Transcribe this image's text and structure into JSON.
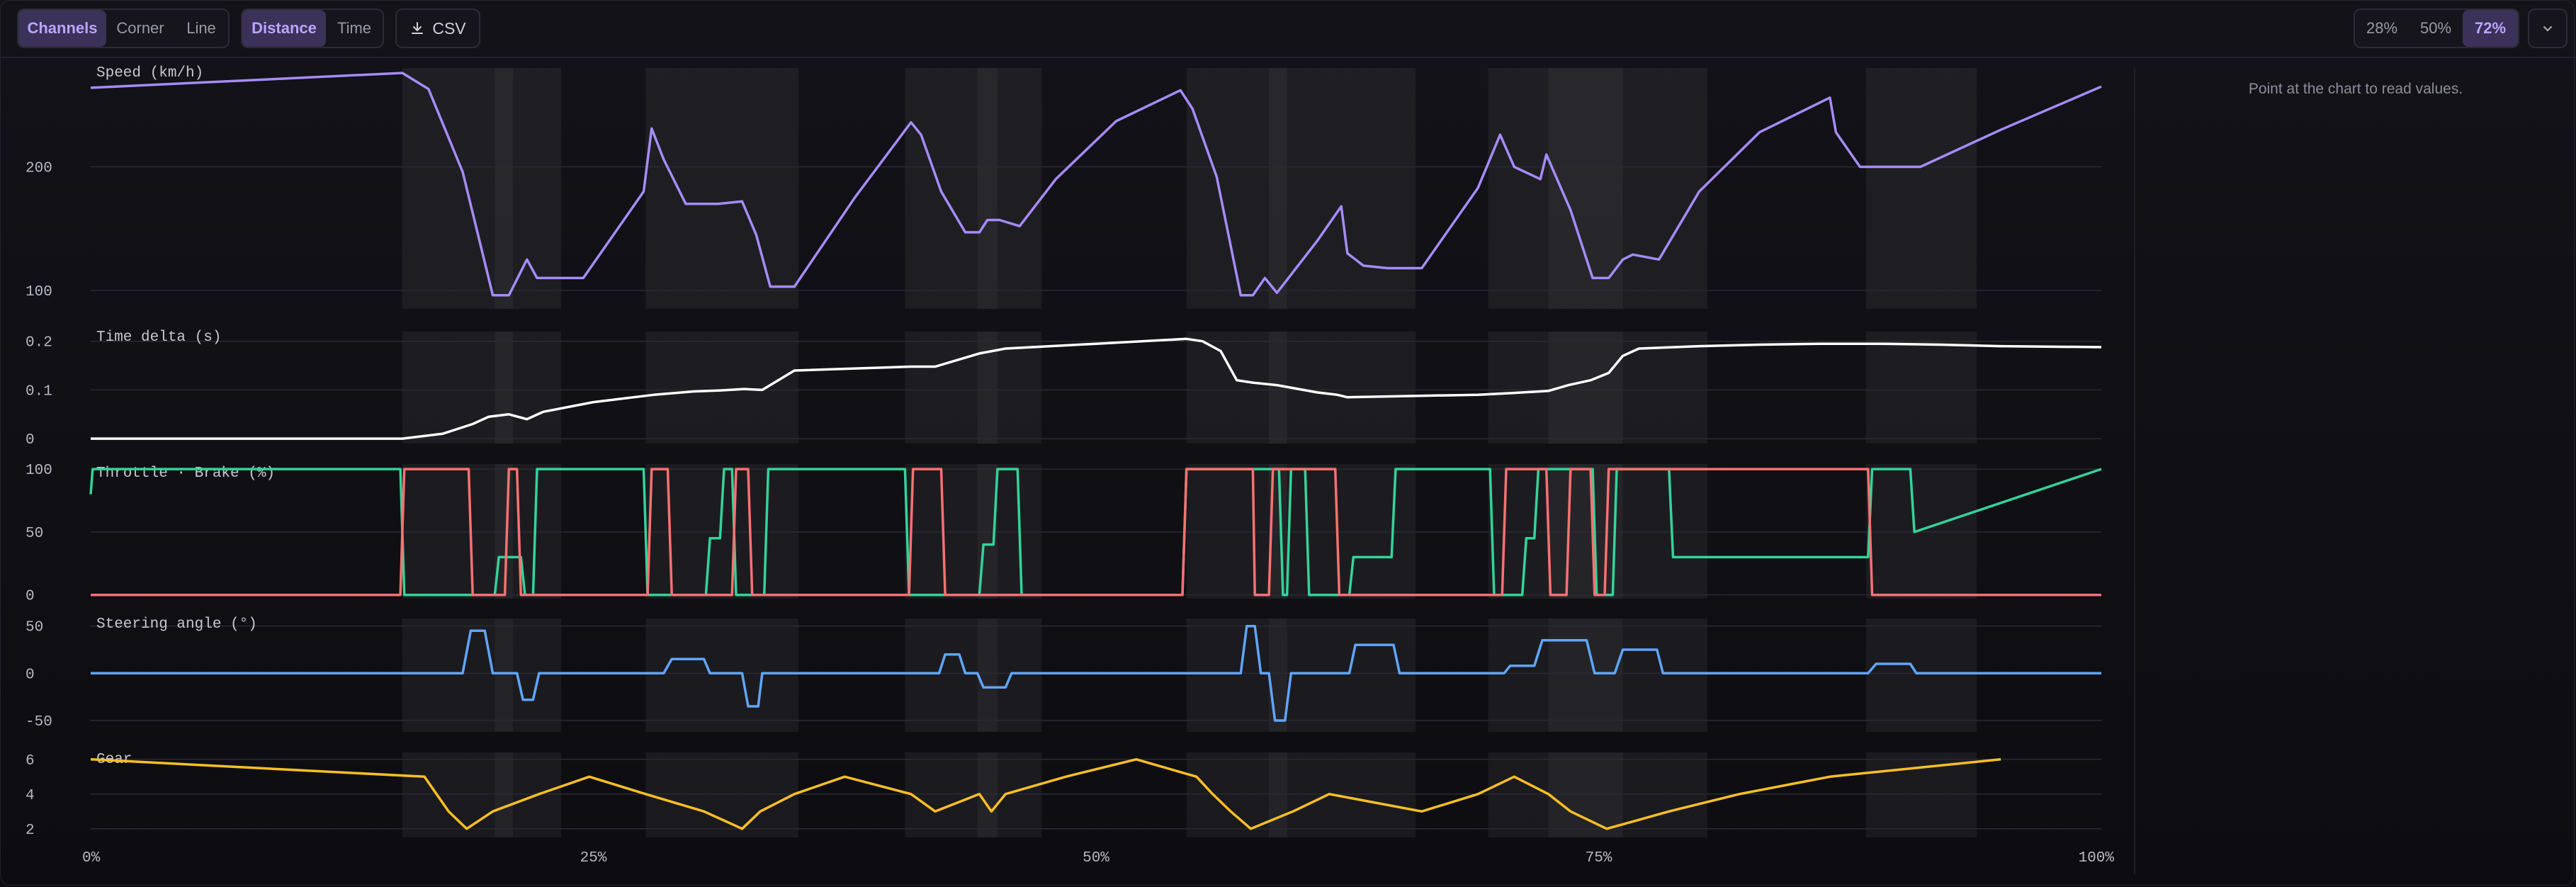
{
  "toolbar": {
    "view_modes": [
      "Channels",
      "Corner",
      "Line"
    ],
    "view_selected": "Channels",
    "axis_modes": [
      "Distance",
      "Time"
    ],
    "axis_selected": "Distance",
    "csv_label": "CSV",
    "zoom_options": [
      "28%",
      "50%",
      "72%"
    ],
    "zoom_selected": "72%"
  },
  "readout": {
    "hint": "Point at the chart to read values."
  },
  "colors": {
    "speed": "#a78bfa",
    "delta": "#ffffff",
    "throttle": "#34d399",
    "brake": "#f87171",
    "steering": "#60a5fa",
    "gear": "#fbbf24",
    "accent": "#b9a6ff"
  },
  "chart_data": [
    {
      "type": "line",
      "title": "Speed (km/h)",
      "ylim": [
        85,
        280
      ],
      "yticks": [
        "100",
        "200"
      ],
      "series": [
        {
          "x": [
            0,
            15.5,
            16.8,
            18.5,
            20,
            20.8,
            21.7,
            22.2,
            24.5,
            27.5,
            27.9,
            28.5,
            29.6,
            31.2,
            32.4,
            33.1,
            33.8,
            35,
            38,
            40.8,
            41.3,
            42.3,
            43.5,
            44.2,
            44.6,
            45.2,
            46.2,
            48,
            51,
            54.2,
            54.8,
            56,
            57.2,
            57.8,
            58.4,
            59,
            61,
            62.2,
            62.5,
            63.3,
            64.5,
            66.2,
            69,
            70.1,
            70.8,
            72.1,
            72.4,
            73.6,
            74.7,
            75.5,
            76.2,
            76.7,
            78,
            80,
            83,
            86.5,
            86.8,
            88,
            91,
            95,
            100
          ],
          "y": [
            264,
            276,
            263,
            196,
            96,
            96,
            125,
            110,
            110,
            180,
            231,
            206,
            170,
            170,
            172,
            145,
            103,
            103,
            175,
            236,
            226,
            180,
            147,
            147,
            157,
            157,
            152,
            190,
            237,
            262,
            247,
            192,
            96,
            96,
            110,
            98,
            140,
            168,
            130,
            120,
            118,
            118,
            183,
            226,
            200,
            190,
            210,
            165,
            110,
            110,
            125,
            129,
            125,
            180,
            228,
            256,
            228,
            200,
            200,
            230,
            265
          ]
        }
      ]
    },
    {
      "type": "line",
      "title": "Time delta (s)",
      "ylim": [
        -0.01,
        0.22
      ],
      "yticks": [
        "0",
        "0.1",
        "0.2"
      ],
      "series": [
        {
          "x": [
            0,
            12,
            15.5,
            17.5,
            19,
            19.8,
            20.8,
            21.7,
            22.5,
            25,
            28,
            30,
            31.3,
            32.5,
            33.4,
            35,
            40.8,
            42,
            44.2,
            45.5,
            50,
            54.5,
            55.3,
            56.2,
            57,
            57.8,
            59,
            61,
            62,
            62.5,
            66,
            69,
            70.8,
            72.5,
            73.5,
            74.6,
            75.5,
            76.2,
            77,
            80,
            83,
            86,
            89,
            92,
            95,
            100
          ],
          "y": [
            0,
            0,
            0,
            0.01,
            0.03,
            0.045,
            0.05,
            0.04,
            0.055,
            0.075,
            0.09,
            0.097,
            0.099,
            0.102,
            0.1,
            0.14,
            0.148,
            0.148,
            0.175,
            0.185,
            0.195,
            0.205,
            0.2,
            0.18,
            0.12,
            0.115,
            0.11,
            0.095,
            0.09,
            0.085,
            0.088,
            0.09,
            0.094,
            0.098,
            0.11,
            0.12,
            0.135,
            0.17,
            0.185,
            0.19,
            0.193,
            0.195,
            0.195,
            0.193,
            0.19,
            0.188
          ]
        }
      ]
    },
    {
      "type": "line",
      "title": "Throttle · Brake (%)",
      "ylim": [
        -3,
        104
      ],
      "yticks": [
        "0",
        "50",
        "100"
      ],
      "series": [
        {
          "name": "Throttle",
          "x": [
            0,
            0.1,
            15.4,
            15.6,
            20.1,
            20.3,
            21.4,
            21.6,
            22,
            22.2,
            27.5,
            27.7,
            30.6,
            30.8,
            31.3,
            31.5,
            31.9,
            32.1,
            33.5,
            33.7,
            40.5,
            40.7,
            44.2,
            44.4,
            44.9,
            45.1,
            46.1,
            46.3,
            54.3,
            54.5,
            59.1,
            59.3,
            59.5,
            59.7,
            60.4,
            60.6,
            62.6,
            62.8,
            64.7,
            64.9,
            69.6,
            69.8,
            71.2,
            71.4,
            71.8,
            72.0,
            74.7,
            74.9,
            75.7,
            75.9,
            78.5,
            78.7,
            88.4,
            88.6,
            90.5,
            90.7,
            100
          ],
          "y": [
            80,
            100,
            100,
            0,
            0,
            30,
            30,
            0,
            0,
            100,
            100,
            0,
            0,
            45,
            45,
            100,
            100,
            0,
            0,
            100,
            100,
            0,
            0,
            40,
            40,
            100,
            100,
            0,
            0,
            100,
            100,
            0,
            0,
            100,
            100,
            0,
            0,
            30,
            30,
            100,
            100,
            0,
            0,
            45,
            45,
            100,
            100,
            0,
            0,
            100,
            100,
            30,
            30,
            100,
            100,
            50,
            100
          ]
        },
        {
          "name": "Brake",
          "x": [
            0,
            15.4,
            15.6,
            18.8,
            19,
            20.6,
            20.8,
            21.2,
            21.4,
            27.7,
            27.9,
            28.7,
            28.9,
            31.9,
            32.1,
            32.7,
            32.9,
            40.7,
            40.9,
            42.3,
            42.5,
            44.4,
            44.6,
            54.3,
            54.5,
            57.8,
            57.9,
            58.6,
            58.8,
            61.9,
            62.1,
            62.4,
            62.6,
            70.2,
            70.4,
            72.4,
            72.6,
            73.4,
            73.6,
            74.6,
            74.8,
            75.3,
            75.5,
            88.4,
            88.6,
            89.3,
            89.5,
            100
          ],
          "y": [
            0,
            0,
            100,
            100,
            0,
            0,
            100,
            100,
            0,
            0,
            100,
            100,
            0,
            0,
            100,
            100,
            0,
            0,
            100,
            100,
            0,
            0,
            0,
            0,
            100,
            100,
            0,
            0,
            100,
            100,
            0,
            0,
            0,
            0,
            100,
            100,
            0,
            0,
            100,
            100,
            0,
            0,
            100,
            100,
            0,
            0,
            0,
            0
          ]
        }
      ]
    },
    {
      "type": "line",
      "title": "Steering angle (°)",
      "ylim": [
        -62,
        58
      ],
      "yticks": [
        "-50",
        "0",
        "50"
      ],
      "series": [
        {
          "x": [
            0,
            18.5,
            18.9,
            19.6,
            20,
            21.2,
            21.5,
            22,
            22.3,
            28.5,
            28.9,
            30.5,
            30.8,
            32.4,
            32.7,
            33.2,
            33.4,
            42.2,
            42.5,
            43.2,
            43.5,
            44.1,
            44.4,
            45.5,
            45.8,
            57.2,
            57.5,
            57.9,
            58.2,
            58.6,
            58.9,
            59.4,
            59.7,
            62.6,
            62.9,
            64.8,
            65.1,
            70.3,
            70.6,
            71.8,
            72.2,
            74.4,
            74.8,
            75.8,
            76.2,
            77.9,
            78.2,
            88.4,
            88.8,
            90.5,
            90.8,
            100
          ],
          "y": [
            0,
            0,
            45,
            45,
            0,
            0,
            -28,
            -28,
            0,
            0,
            15,
            15,
            0,
            0,
            -35,
            -35,
            0,
            0,
            20,
            20,
            0,
            0,
            -15,
            -15,
            0,
            0,
            50,
            50,
            0,
            0,
            -50,
            -50,
            0,
            0,
            30,
            30,
            0,
            0,
            8,
            8,
            35,
            35,
            0,
            0,
            25,
            25,
            0,
            0,
            10,
            10,
            0,
            0
          ]
        }
      ]
    },
    {
      "type": "line",
      "title": "Gear",
      "ylim": [
        1.5,
        6.4
      ],
      "yticks": [
        "2",
        "4",
        "6"
      ],
      "series": [
        {
          "x": [
            0,
            16.6,
            17.2,
            17.8,
            18.7,
            20,
            22.3,
            24.8,
            27.6,
            30.5,
            32.4,
            33.3,
            35,
            37.5,
            40.8,
            42,
            44.2,
            44.8,
            45.5,
            48.5,
            52,
            55,
            55.8,
            56.7,
            57.7,
            59.8,
            61.6,
            66.2,
            69,
            70.8,
            72.5,
            73.6,
            75.4,
            78.5,
            82,
            86.5,
            95
          ],
          "y": [
            6,
            5,
            4,
            3,
            2,
            3,
            4,
            5,
            4,
            3,
            2,
            3,
            4,
            5,
            4,
            3,
            4,
            3,
            4,
            5,
            6,
            5,
            4,
            3,
            2,
            3,
            4,
            3,
            4,
            5,
            4,
            3,
            2,
            3,
            4,
            5,
            6
          ]
        }
      ]
    }
  ],
  "x_axis": {
    "ticks": [
      "0%",
      "25%",
      "50%",
      "75%",
      "100%"
    ],
    "xlim": [
      0,
      100
    ]
  },
  "corner_zones": [
    [
      15.5,
      23.4
    ],
    [
      27.6,
      35.2
    ],
    [
      40.5,
      47.3
    ],
    [
      54.5,
      65.9
    ],
    [
      69.5,
      80.4
    ],
    [
      88.3,
      93.8
    ]
  ],
  "apex_zones": [
    [
      20.1,
      21.0
    ],
    [
      44.1,
      45.1
    ],
    [
      58.6,
      59.5
    ],
    [
      72.5,
      76.2
    ]
  ]
}
